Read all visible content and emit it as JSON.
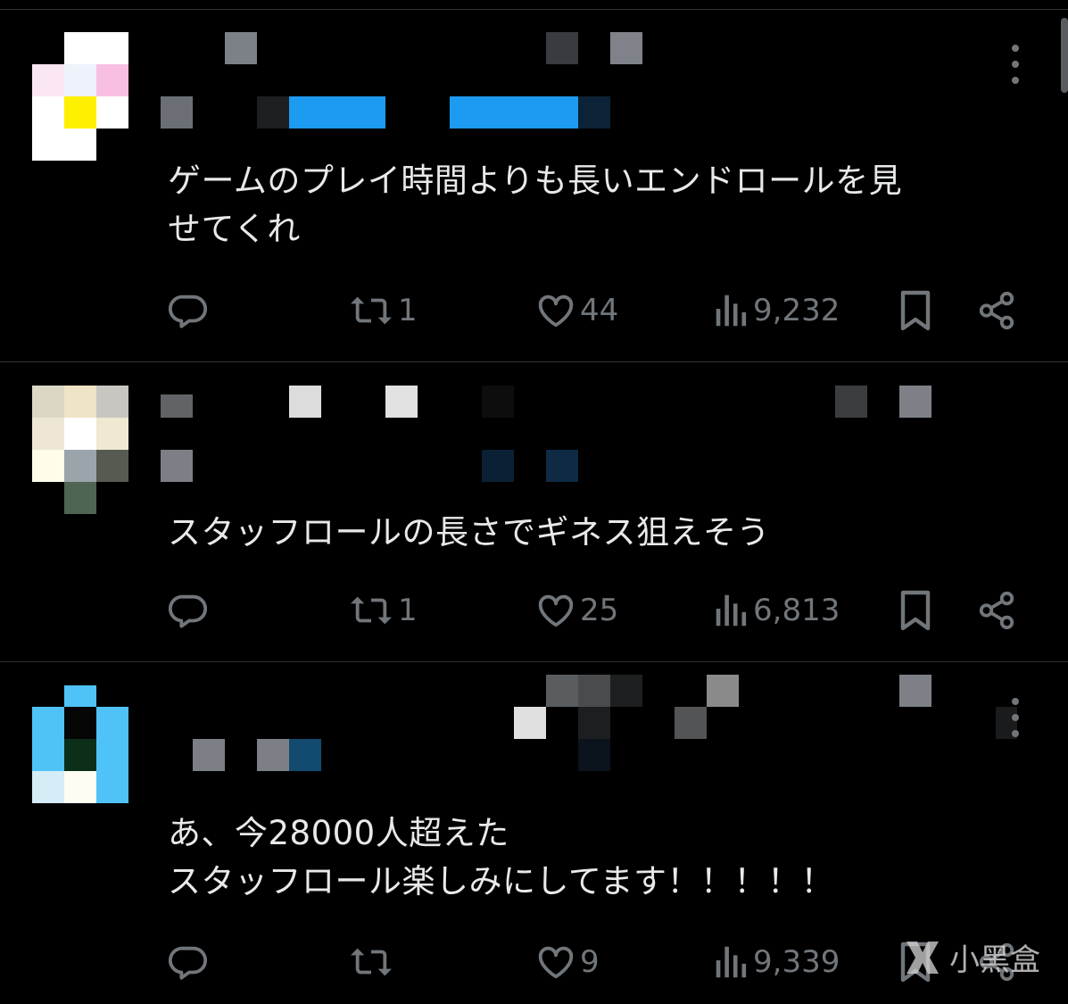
{
  "posts": [
    {
      "text": "ゲームのプレイ時間よりも長いエンドロールを見\nせてくれ",
      "replies": "",
      "reposts": "1",
      "likes": "44",
      "views": "9,232"
    },
    {
      "text": "スタッフロールの長さでギネス狙えそう",
      "replies": "",
      "reposts": "1",
      "likes": "25",
      "views": "6,813"
    },
    {
      "text": "あ、今28000人超えた\nスタッフロール楽しみにしてます！！！！！",
      "replies": "",
      "reposts": "",
      "likes": "9",
      "views": "9,339"
    }
  ],
  "watermark": {
    "text": "小黑盒"
  },
  "colors": {
    "background": "#000000",
    "text": "#e7e9ea",
    "muted": "#71767b",
    "divider": "#2f3336"
  },
  "icons": [
    "reply-icon",
    "repost-icon",
    "like-icon",
    "views-icon",
    "bookmark-icon",
    "share-icon",
    "more-icon"
  ]
}
